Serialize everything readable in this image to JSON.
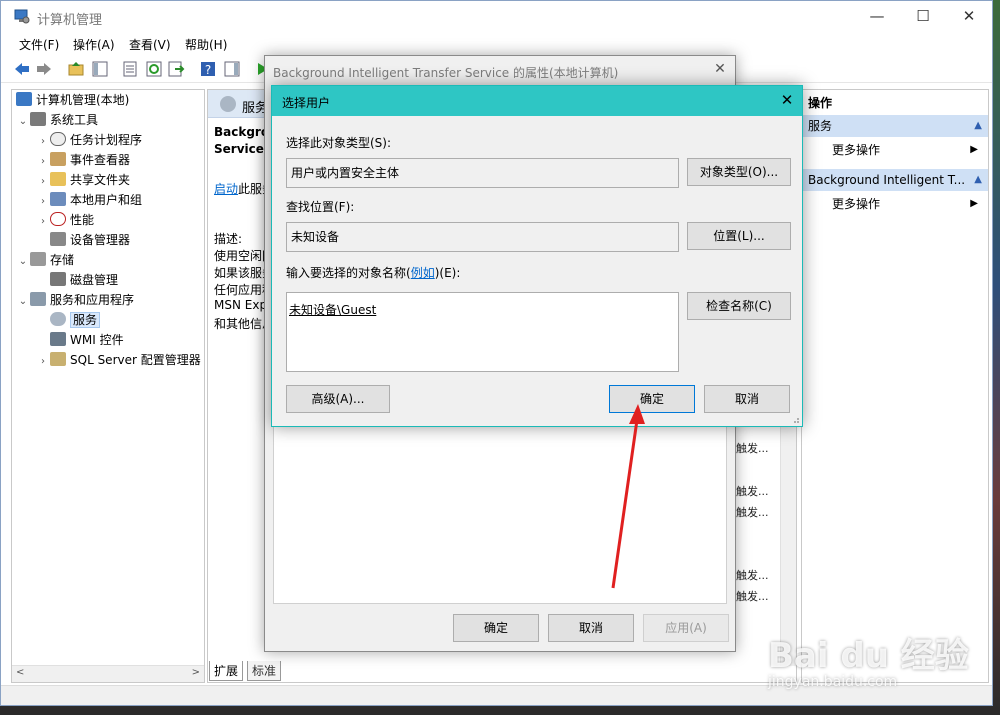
{
  "window": {
    "title": "计算机管理",
    "menu": [
      "文件(F)",
      "操作(A)",
      "查看(V)",
      "帮助(H)"
    ],
    "controls": {
      "minimize": "—",
      "maximize": "☐",
      "close": "✕"
    }
  },
  "tree": {
    "root": "计算机管理(本地)",
    "items": [
      {
        "label": "系统工具",
        "level": 1,
        "arrow": "⌄"
      },
      {
        "label": "任务计划程序",
        "level": 2,
        "arrow": "›"
      },
      {
        "label": "事件查看器",
        "level": 2,
        "arrow": "›"
      },
      {
        "label": "共享文件夹",
        "level": 2,
        "arrow": "›"
      },
      {
        "label": "本地用户和组",
        "level": 2,
        "arrow": "›"
      },
      {
        "label": "性能",
        "level": 2,
        "arrow": "›"
      },
      {
        "label": "设备管理器",
        "level": 2,
        "arrow": ""
      },
      {
        "label": "存储",
        "level": 1,
        "arrow": "⌄"
      },
      {
        "label": "磁盘管理",
        "level": 2,
        "arrow": ""
      },
      {
        "label": "服务和应用程序",
        "level": 1,
        "arrow": "⌄"
      },
      {
        "label": "服务",
        "level": 2,
        "arrow": "",
        "selected": true
      },
      {
        "label": "WMI 控件",
        "level": 2,
        "arrow": ""
      },
      {
        "label": "SQL Server 配置管理器",
        "level": 2,
        "arrow": "›"
      }
    ]
  },
  "center": {
    "header": "服务",
    "service_name_1": "Backgrou",
    "service_name_2": "Service",
    "start_link": "启动",
    "start_suffix": "此服务",
    "desc_label": "描述:",
    "desc_lines": [
      "使用空闲网",
      "如果该服务",
      "任何应用程",
      "MSN Exp",
      "和其他信息"
    ],
    "right_fragments": [
      "触发...",
      "触发...",
      "触发...",
      "触发...",
      "触发..."
    ],
    "tabs": [
      "扩展",
      "标准"
    ]
  },
  "actions": {
    "title": "操作",
    "section1": "服务",
    "more1": "更多操作",
    "section2": "Background Intelligent T...",
    "more2": "更多操作"
  },
  "props_dialog": {
    "title": "Background Intelligent Transfer Service 的属性(本地计算机)",
    "ok": "确定",
    "cancel": "取消",
    "apply": "应用(A)"
  },
  "select_user_dialog": {
    "title": "选择用户",
    "object_type_label": "选择此对象类型(S):",
    "object_type_value": "用户或内置安全主体",
    "object_type_button": "对象类型(O)...",
    "location_label": "查找位置(F):",
    "location_value": "未知设备",
    "location_button": "位置(L)...",
    "name_label_prefix": "输入要选择的对象名称(",
    "name_label_link": "例如",
    "name_label_suffix": ")(E):",
    "name_value": "未知设备\\Guest",
    "check_names_button": "检查名称(C)",
    "advanced_button": "高级(A)...",
    "ok_button": "确定",
    "cancel_button": "取消"
  },
  "watermark": {
    "logo": "Bai du 经验",
    "url": "jingyan.baidu.com"
  },
  "colors": {
    "dialog_title_bar": "#2ec6c4",
    "arrow": "#e02020",
    "selection": "#d9e8fb"
  }
}
